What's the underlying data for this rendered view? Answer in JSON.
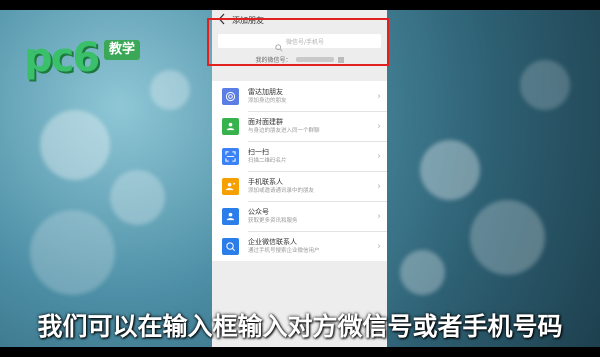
{
  "logo": {
    "brand": "pc6",
    "badge": "教学"
  },
  "phone": {
    "title": "添加朋友",
    "search_placeholder": "微信号/手机号",
    "my_id_label": "我的微信号：",
    "list": [
      {
        "title": "雷达加朋友",
        "sub": "添加身边的朋友",
        "color": "#5b7ee5",
        "icon": "radar-icon"
      },
      {
        "title": "面对面建群",
        "sub": "与身边的朋友进入同一个群聊",
        "color": "#37b24d",
        "icon": "group-icon"
      },
      {
        "title": "扫一扫",
        "sub": "扫描二维码名片",
        "color": "#3b82f6",
        "icon": "scan-icon"
      },
      {
        "title": "手机联系人",
        "sub": "添加或邀请通讯录中的朋友",
        "color": "#f59f00",
        "icon": "contacts-icon"
      },
      {
        "title": "公众号",
        "sub": "获取更多资讯和服务",
        "color": "#2b7de9",
        "icon": "official-account-icon"
      },
      {
        "title": "企业微信联系人",
        "sub": "通过手机号搜索企业微信用户",
        "color": "#2b7de9",
        "icon": "wecom-icon"
      }
    ]
  },
  "caption": "我们可以在输入框输入对方微信号或者手机号码",
  "colors": {
    "highlight": "#e22020"
  }
}
